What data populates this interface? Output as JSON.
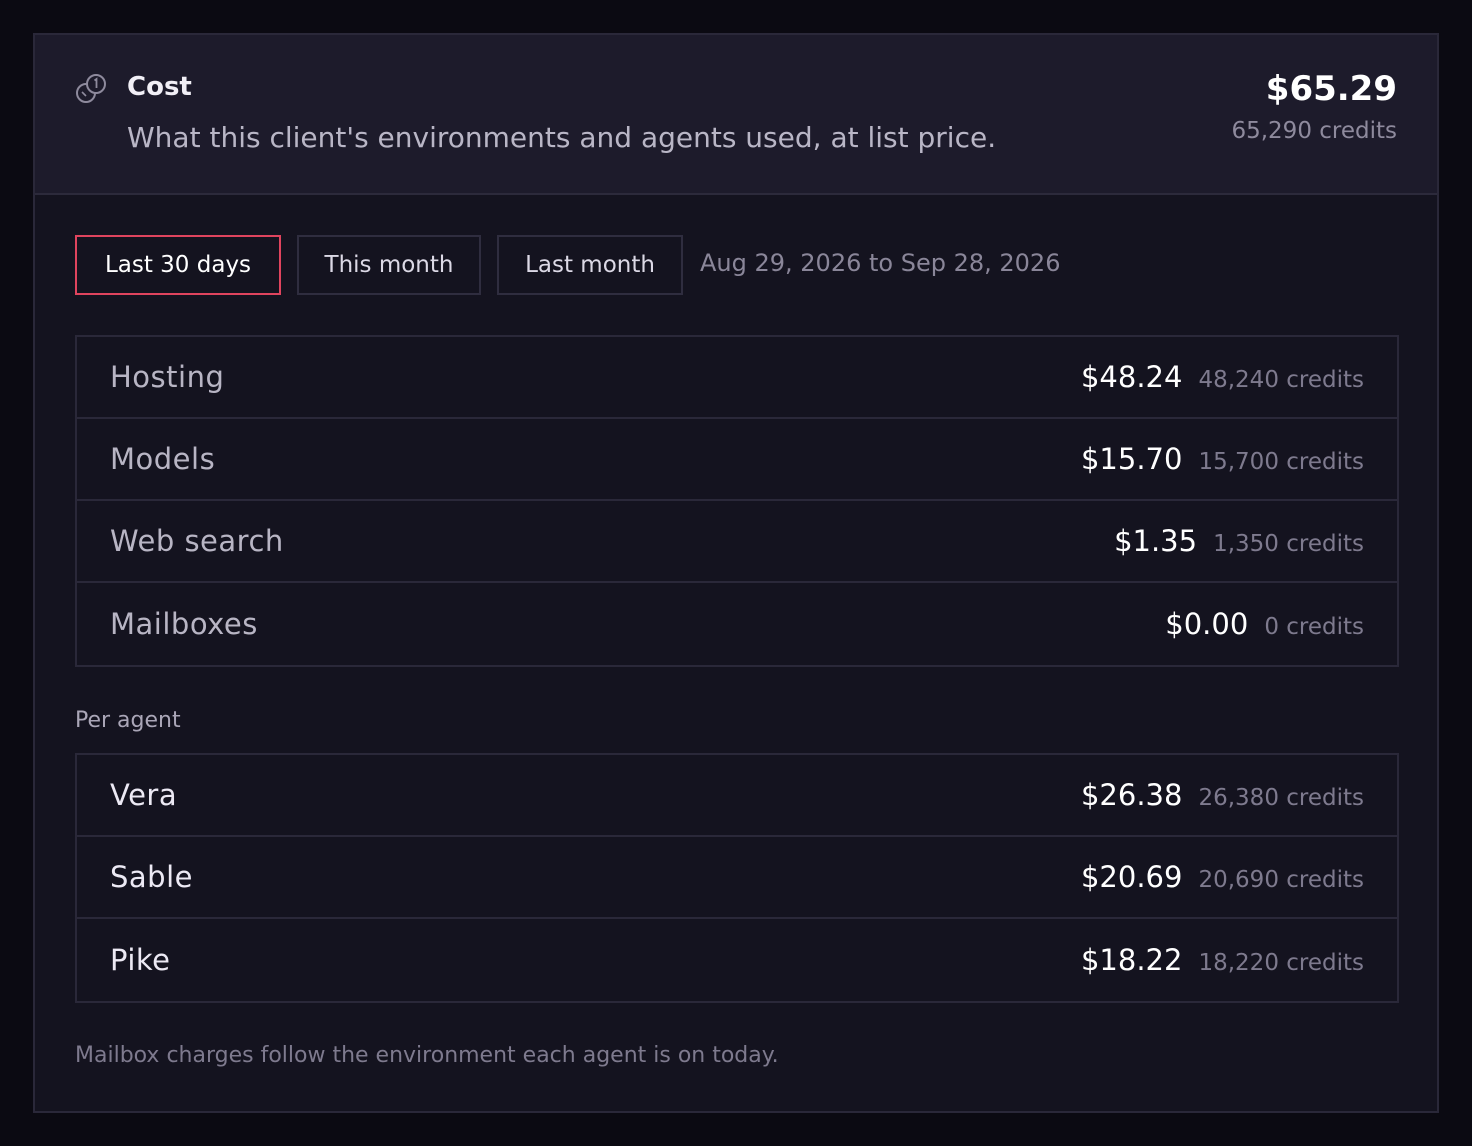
{
  "header": {
    "title": "Cost",
    "subtitle": "What this client's environments and agents used, at list price.",
    "total": "$65.29",
    "total_credits": "65,290 credits"
  },
  "tabs": [
    {
      "label": "Last 30 days",
      "active": true
    },
    {
      "label": "This month",
      "active": false
    },
    {
      "label": "Last month",
      "active": false
    }
  ],
  "date_range": "Aug 29, 2026 to Sep 28, 2026",
  "categories": [
    {
      "label": "Hosting",
      "amount": "$48.24",
      "credits": "48,240 credits"
    },
    {
      "label": "Models",
      "amount": "$15.70",
      "credits": "15,700 credits"
    },
    {
      "label": "Web search",
      "amount": "$1.35",
      "credits": "1,350 credits"
    },
    {
      "label": "Mailboxes",
      "amount": "$0.00",
      "credits": "0 credits"
    }
  ],
  "per_agent": {
    "label": "Per agent",
    "agents": [
      {
        "name": "Vera",
        "amount": "$26.38",
        "credits": "26,380 credits"
      },
      {
        "name": "Sable",
        "amount": "$20.69",
        "credits": "20,690 credits"
      },
      {
        "name": "Pike",
        "amount": "$18.22",
        "credits": "18,220 credits"
      }
    ]
  },
  "footnote": "Mailbox charges follow the environment each agent is on today.",
  "colors": {
    "accent": "#e0445e",
    "card_bg": "#14131f",
    "header_bg": "#1d1b2b"
  },
  "icons": {
    "header": "coins-icon"
  }
}
